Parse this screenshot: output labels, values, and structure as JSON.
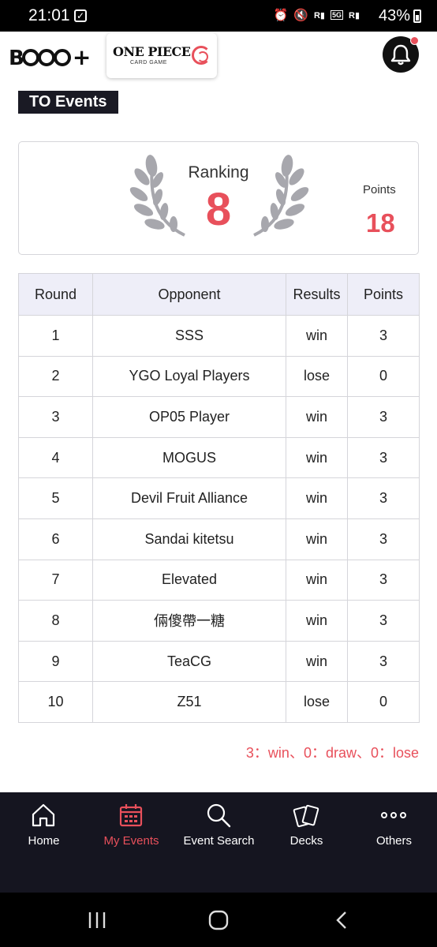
{
  "status_bar": {
    "time": "21:01",
    "battery": "43%",
    "network": "5G"
  },
  "header": {
    "brand_logo": "B",
    "brand_plus": "+",
    "game_logo_title": "ONE PIECE",
    "game_logo_sub": "CARD GAME",
    "notification_icon": "bell-icon",
    "has_unread": true
  },
  "page": {
    "section_title": "TO Events"
  },
  "ranking": {
    "label": "Ranking",
    "value": "8",
    "points_label": "Points",
    "points_value": "18"
  },
  "table": {
    "headers": [
      "Round",
      "Opponent",
      "Results",
      "Points"
    ],
    "rows": [
      {
        "round": "1",
        "opponent": "SSS",
        "result": "win",
        "points": "3"
      },
      {
        "round": "2",
        "opponent": "YGO Loyal Players",
        "result": "lose",
        "points": "0"
      },
      {
        "round": "3",
        "opponent": "OP05 Player",
        "result": "win",
        "points": "3"
      },
      {
        "round": "4",
        "opponent": "MOGUS",
        "result": "win",
        "points": "3"
      },
      {
        "round": "5",
        "opponent": "Devil Fruit Alliance",
        "result": "win",
        "points": "3"
      },
      {
        "round": "6",
        "opponent": "Sandai kitetsu",
        "result": "win",
        "points": "3"
      },
      {
        "round": "7",
        "opponent": "Elevated",
        "result": "win",
        "points": "3"
      },
      {
        "round": "8",
        "opponent": "倆傻帶一糖",
        "result": "win",
        "points": "3"
      },
      {
        "round": "9",
        "opponent": "TeaCG",
        "result": "win",
        "points": "3"
      },
      {
        "round": "10",
        "opponent": "Z51",
        "result": "lose",
        "points": "0"
      }
    ]
  },
  "legend": "3：win、0：draw、0：lose",
  "bottom_nav": {
    "items": [
      {
        "label": "Home",
        "icon": "home-icon",
        "active": false
      },
      {
        "label": "My Events",
        "icon": "calendar-icon",
        "active": true
      },
      {
        "label": "Event Search",
        "icon": "search-icon",
        "active": false
      },
      {
        "label": "Decks",
        "icon": "cards-icon",
        "active": false
      },
      {
        "label": "Others",
        "icon": "more-icon",
        "active": false
      }
    ]
  },
  "colors": {
    "accent": "#e8505b",
    "nav_background": "#151520",
    "title_background": "#1a1a24",
    "table_header": "#eeeef8"
  }
}
